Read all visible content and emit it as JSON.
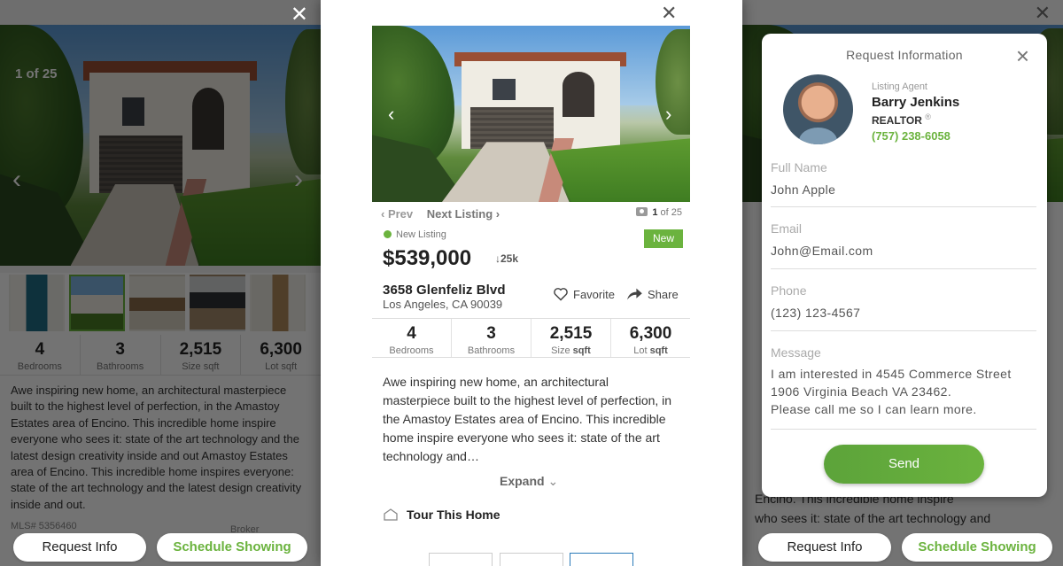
{
  "left": {
    "photo_counter": "1 of 25",
    "stats": [
      {
        "value": "4",
        "label": "Bedrooms"
      },
      {
        "value": "3",
        "label": "Bathrooms"
      },
      {
        "value": "2,515",
        "label": "Size sqft"
      },
      {
        "value": "6,300",
        "label": "Lot sqft"
      }
    ],
    "description": "Awe inspiring new home, an architectural masterpiece built to the highest level of perfection, in the Amastoy Estates area of Encino. This incredible home inspire everyone who sees it: state of the art technology and the latest design creativity inside and out Amastoy Estates area of Encino. This incredible home inspires everyone: state of the art technology and the latest design creativity inside and out.",
    "mls": "MLS# 5356460",
    "broker": "Broker",
    "request_info": "Request Info",
    "schedule_showing": "Schedule Showing"
  },
  "center": {
    "prev": "‹ Prev",
    "next": "Next Listing ›",
    "photo_count_current": "1",
    "photo_count_total": "of 25",
    "status": "New Listing",
    "badge": "New",
    "price": "$539,000",
    "price_drop": "↓25k",
    "address_line1": "3658 Glenfeliz Blvd",
    "address_line2": "Los Angeles, CA 90039",
    "favorite": "Favorite",
    "share": "Share",
    "stats": [
      {
        "value": "4",
        "label": "Bedrooms",
        "unit": ""
      },
      {
        "value": "3",
        "label": "Bathrooms",
        "unit": ""
      },
      {
        "value": "2,515",
        "label": "Size",
        "unit": "sqft"
      },
      {
        "value": "6,300",
        "label": "Lot",
        "unit": "sqft"
      }
    ],
    "description": "Awe inspiring new home, an architectural masterpiece built to the highest level of perfection, in the Amastoy Estates area of Encino. This incredible home inspire everyone who sees it: state of the art technology and…",
    "expand": "Expand",
    "tour": "Tour This Home"
  },
  "right": {
    "bg_text_1": "Encino. This incredible home inspire",
    "bg_text_2": "who sees it: state of the art technology and",
    "request_info": "Request Info",
    "schedule_showing": "Schedule Showing"
  },
  "modal": {
    "title": "Request Information",
    "agent_label": "Listing Agent",
    "agent_name": "Barry Jenkins",
    "agent_title": "REALTOR",
    "agent_title_mark": "®",
    "agent_phone": "(757) 238-6058",
    "fields": {
      "full_name_label": "Full Name",
      "full_name_value": "John Apple",
      "email_label": "Email",
      "email_value": "John@Email.com",
      "phone_label": "Phone",
      "phone_value": "(123) 123-4567",
      "message_label": "Message",
      "message_line1": "I am interested in 4545 Commerce Street",
      "message_line2": "1906 Virginia Beach VA 23462.",
      "message_line3": "Please call me so I can learn more."
    },
    "send": "Send"
  },
  "colors": {
    "accent_green": "#6bb33e",
    "active_blue": "#2b7bb9"
  }
}
